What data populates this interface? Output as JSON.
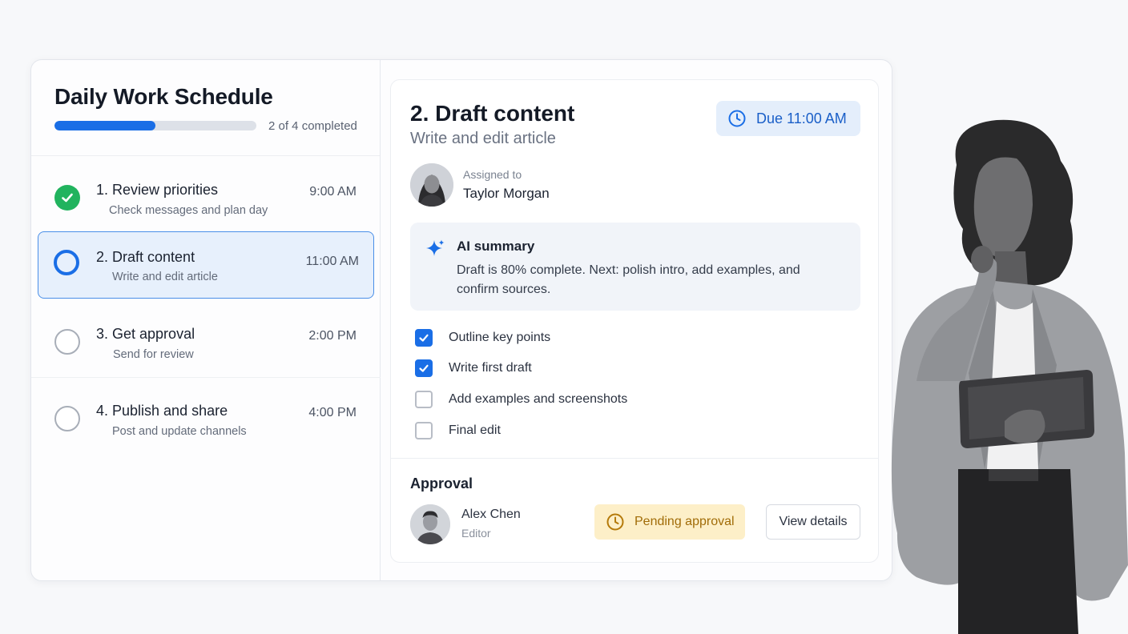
{
  "schedule": {
    "title": "Daily Work Schedule",
    "progress": {
      "completed": 2,
      "total": 4,
      "fraction": 0.5,
      "label": "2 of 4 completed"
    },
    "tasks": [
      {
        "title": "1. Review priorities",
        "subtitle": "Check messages and plan day",
        "time": "9:00 AM",
        "status": "done"
      },
      {
        "title": "2. Draft content",
        "subtitle": "Write and edit article",
        "time": "11:00 AM",
        "status": "active"
      },
      {
        "title": "3. Get approval",
        "subtitle": "Send for review",
        "time": "2:00 PM",
        "status": "todo"
      },
      {
        "title": "4. Publish and share",
        "subtitle": "Post and update channels",
        "time": "4:00 PM",
        "status": "todo"
      }
    ]
  },
  "detail": {
    "title": "2. Draft content",
    "subtitle": "Write and edit article",
    "due": "Due 11:00 AM",
    "assigned_label": "Assigned to",
    "assignee": "Taylor Morgan",
    "ai_summary": {
      "title": "AI summary",
      "text": "Draft is 80% complete. Next: polish intro, add examples, and confirm sources."
    },
    "checklist": [
      {
        "label": "Outline key points",
        "checked": true
      },
      {
        "label": "Write first draft",
        "checked": true
      },
      {
        "label": "Add examples and screenshots",
        "checked": false
      },
      {
        "label": "Final edit",
        "checked": false
      }
    ],
    "approval": {
      "title": "Approval",
      "approver": "Alex Chen",
      "role": "Editor",
      "status": "Pending approval",
      "view_button": "View details"
    }
  },
  "icons": {
    "due": "clock-icon",
    "ai": "sparkle-icon",
    "pending": "clock-icon",
    "done": "check-circle-icon"
  },
  "colors": {
    "accent": "#1a6ee6",
    "success": "#21b35e",
    "pending_bg": "#fdefc8",
    "pending_text": "#a16c08",
    "active_bg": "#e7f0fc"
  }
}
